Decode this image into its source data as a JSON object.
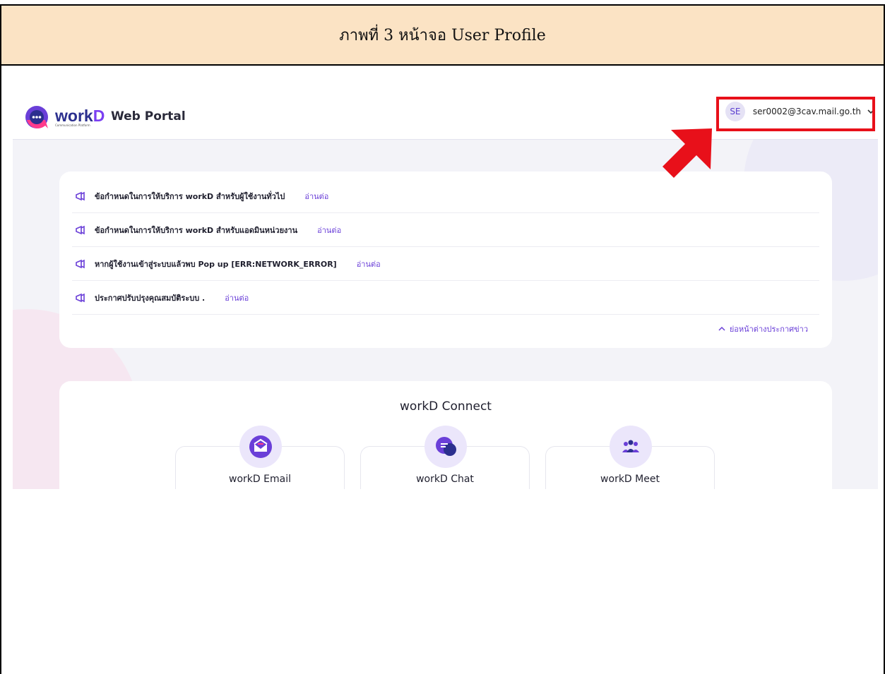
{
  "caption": "ภาพที่ 3 หน้าจอ User Profile",
  "header": {
    "logo_text": "work",
    "logo_accent": "D",
    "logo_tagline": "Communication Platform",
    "title": "Web Portal",
    "user": {
      "initials": "SE",
      "email": "ser0002@3cav.mail.go.th"
    }
  },
  "news": {
    "items": [
      {
        "text": "ข้อกำหนดในการให้บริการ workD สำหรับผู้ใช้งานทั่วไป",
        "link": "อ่านต่อ"
      },
      {
        "text": "ข้อกำหนดในการให้บริการ workD สำหรับแอดมินหน่วยงาน",
        "link": "อ่านต่อ"
      },
      {
        "text": "หากผู้ใช้งานเข้าสู่ระบบแล้วพบ Pop up [ERR:NETWORK_ERROR]",
        "link": "อ่านต่อ"
      },
      {
        "text": "ประกาศปรับปรุงคุณสมบัติระบบ .",
        "link": "อ่านต่อ"
      }
    ],
    "collapse_label": "ย่อหน้าต่างประกาศข่าว"
  },
  "connect": {
    "title": "workD Connect",
    "apps": [
      {
        "label": "workD Email",
        "icon": "email-icon"
      },
      {
        "label": "workD Chat",
        "icon": "chat-icon"
      },
      {
        "label": "workD Meet",
        "icon": "meet-icon"
      }
    ]
  },
  "colors": {
    "accent": "#6a3fd8",
    "highlight": "#e8101a",
    "caption_bg": "#fbe3c4"
  }
}
